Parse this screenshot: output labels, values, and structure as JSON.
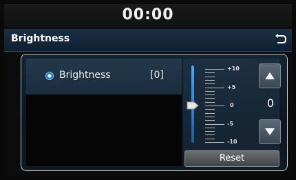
{
  "status": {
    "clock": "00:00"
  },
  "header": {
    "title": "Brightness",
    "back_icon": "back-arrow-icon"
  },
  "setting": {
    "label": "Brightness",
    "value": "[0]",
    "selected": true
  },
  "slider": {
    "min": -10,
    "max": 10,
    "current": 0,
    "labels": [
      "+10",
      "+5",
      "0",
      "-5",
      "-10"
    ],
    "display_value": "0",
    "accent": "#4ea6ff"
  },
  "controls": {
    "up_icon": "triangle-up-icon",
    "down_icon": "triangle-down-icon",
    "reset_label": "Reset"
  }
}
